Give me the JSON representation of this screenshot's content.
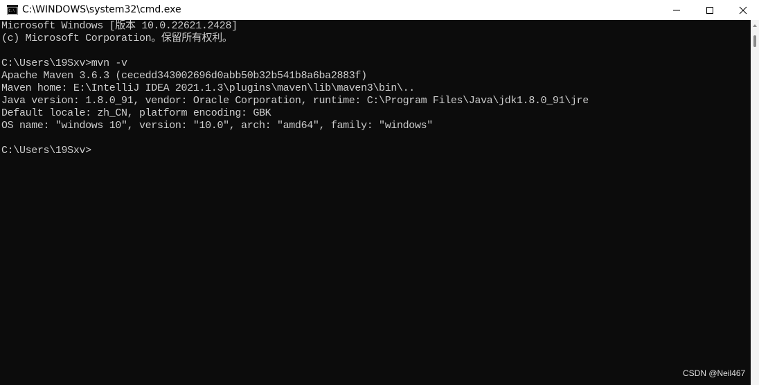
{
  "window": {
    "title": "C:\\WINDOWS\\system32\\cmd.exe",
    "icon": "cmd-icon"
  },
  "controls": {
    "minimize_icon": "minimize-icon",
    "maximize_icon": "maximize-icon",
    "close_icon": "close-icon"
  },
  "console": {
    "lines": [
      "Microsoft Windows [版本 10.0.22621.2428]",
      "(c) Microsoft Corporation。保留所有权利。",
      "",
      "C:\\Users\\19Sxv>mvn -v",
      "Apache Maven 3.6.3 (cecedd343002696d0abb50b32b541b8a6ba2883f)",
      "Maven home: E:\\IntelliJ IDEA 2021.1.3\\plugins\\maven\\lib\\maven3\\bin\\..",
      "Java version: 1.8.0_91, vendor: Oracle Corporation, runtime: C:\\Program Files\\Java\\jdk1.8.0_91\\jre",
      "Default locale: zh_CN, platform encoding: GBK",
      "OS name: \"windows 10\", version: \"10.0\", arch: \"amd64\", family: \"windows\"",
      "",
      "C:\\Users\\19Sxv>"
    ]
  },
  "colors": {
    "console_bg": "#0c0c0c",
    "console_fg": "#cccccc",
    "titlebar_bg": "#ffffff"
  },
  "watermark": "CSDN @Neil467"
}
